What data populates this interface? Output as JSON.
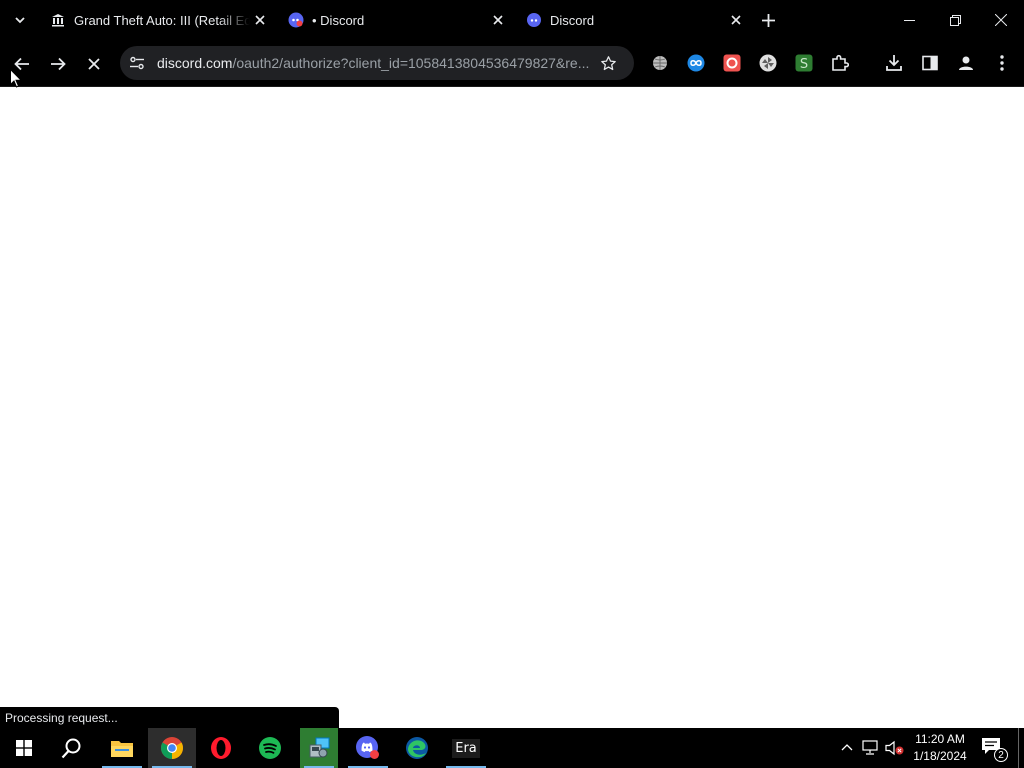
{
  "browser": {
    "tabs": [
      {
        "title": "Grand Theft Auto: III (Retail Edition)",
        "favicon": "bank-icon",
        "active": false
      },
      {
        "title": "• Discord",
        "favicon": "discord-notification-icon",
        "active": false
      },
      {
        "title": "Discord",
        "favicon": "discord-icon",
        "active": true
      }
    ],
    "url_host": "discord.com",
    "url_path": "/oauth2/authorize?client_id=1058413804536479827&re...",
    "status_text": "Processing request...",
    "extensions": [
      "globe-icon",
      "infinity-icon",
      "opera-gx-icon",
      "pinwheel-icon",
      "s-icon",
      "puzzle-icon"
    ]
  },
  "taskbar": {
    "apps": [
      "windows-start-icon",
      "search-icon",
      "file-explorer-icon",
      "chrome-icon",
      "opera-icon",
      "spotify-icon",
      "control-panel-icon",
      "discord-icon",
      "edge-icon",
      "era-icon"
    ],
    "era_label": "Era",
    "time": "11:20 AM",
    "date": "1/18/2024",
    "notification_count": "2"
  },
  "colors": {
    "chrome_dark": "#000000",
    "omnibox": "#202124",
    "text_light": "#e8eaed",
    "text_muted": "#9aa0a6",
    "discord_blurple": "#5865f2",
    "spotify_green": "#1db954"
  }
}
